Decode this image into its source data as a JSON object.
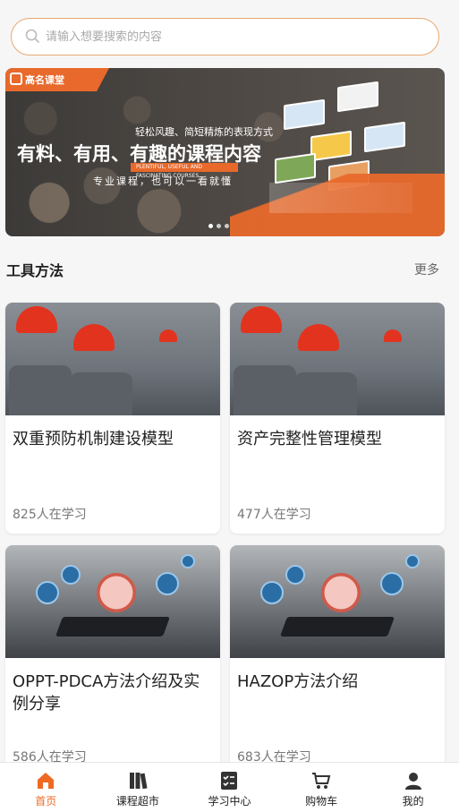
{
  "search": {
    "placeholder": "请输入想要搜索的内容"
  },
  "banner": {
    "brand": "高名课堂",
    "subtitle": "轻松风趣、简短精炼的表现方式",
    "headline": "有料、有用、有趣的课程内容",
    "english": "PLENTIFUL, USEFUL AND FASCINATING COURSES",
    "tagline": "专业课程，也可以一看就懂",
    "active_slide": 1,
    "slide_count": 3
  },
  "section": {
    "title": "工具方法",
    "more": "更多"
  },
  "courses": [
    {
      "name": "双重预防机制建设模型",
      "count": "825人在学习"
    },
    {
      "name": "资产完整性管理模型",
      "count": "477人在学习"
    },
    {
      "name": "OPPT-PDCA方法介绍及实例分享",
      "count": "586人在学习"
    },
    {
      "name": "HAZOP方法介绍",
      "count": "683人在学习"
    }
  ],
  "tabs": [
    {
      "label": "首页",
      "icon": "home-icon"
    },
    {
      "label": "课程超市",
      "icon": "books-icon"
    },
    {
      "label": "学习中心",
      "icon": "checklist-icon"
    },
    {
      "label": "购物车",
      "icon": "cart-icon"
    },
    {
      "label": "我的",
      "icon": "user-icon"
    }
  ],
  "colors": {
    "accent": "#ee6a24",
    "brand_orange": "#e8692b"
  }
}
